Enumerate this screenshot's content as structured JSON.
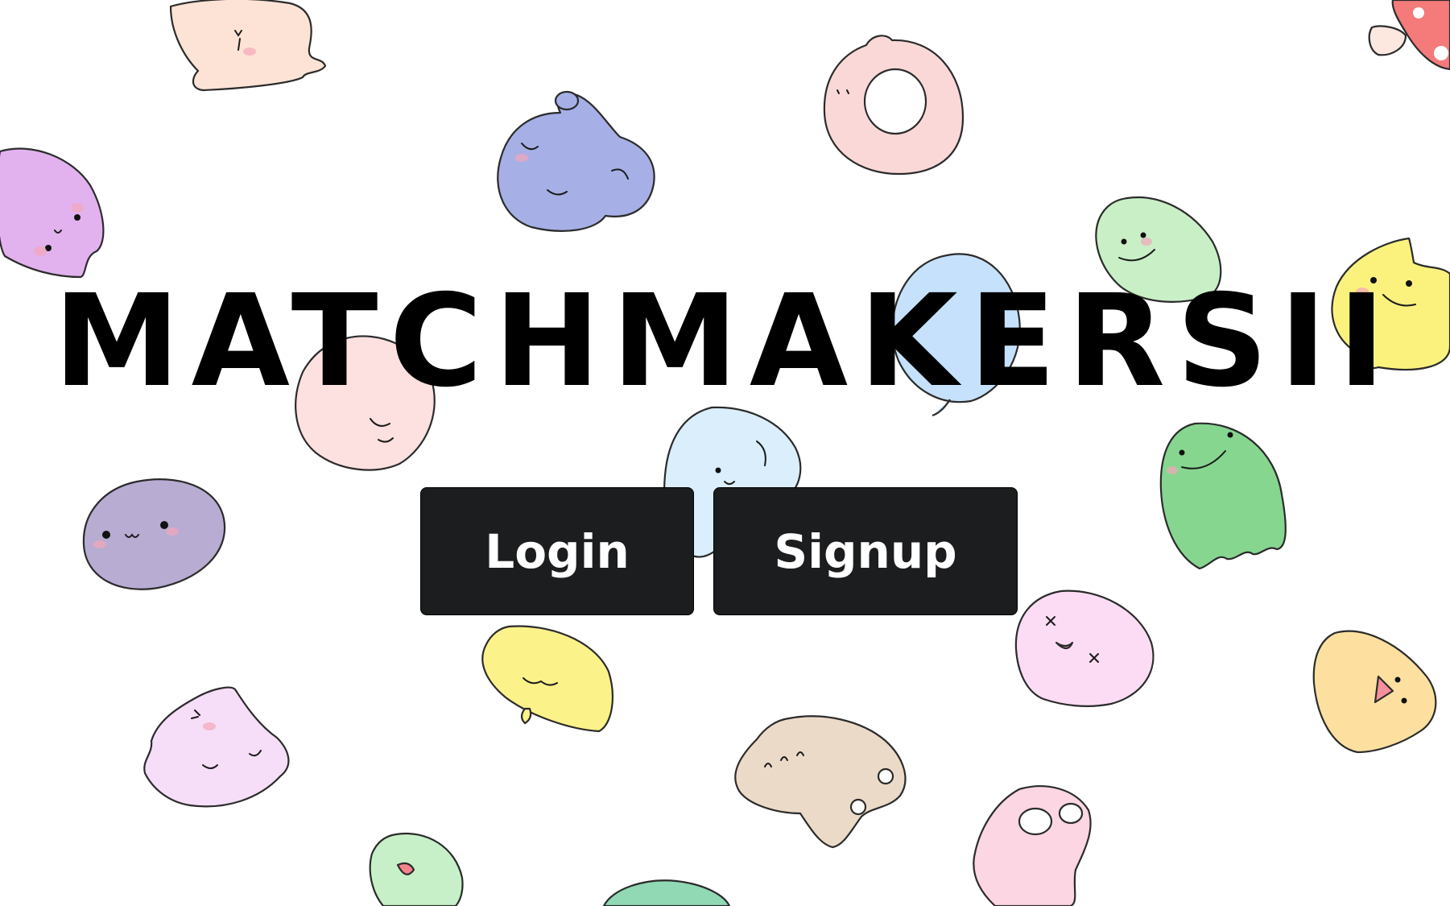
{
  "app": {
    "title": "MATCHMAKERSII"
  },
  "actions": {
    "login_label": "Login",
    "signup_label": "Signup"
  },
  "colors": {
    "button_bg": "#1c1d1f",
    "button_text": "#ffffff",
    "title": "#000000",
    "background": "#ffffff"
  },
  "background": {
    "illustration": "pastel-blob-creatures-pattern"
  }
}
